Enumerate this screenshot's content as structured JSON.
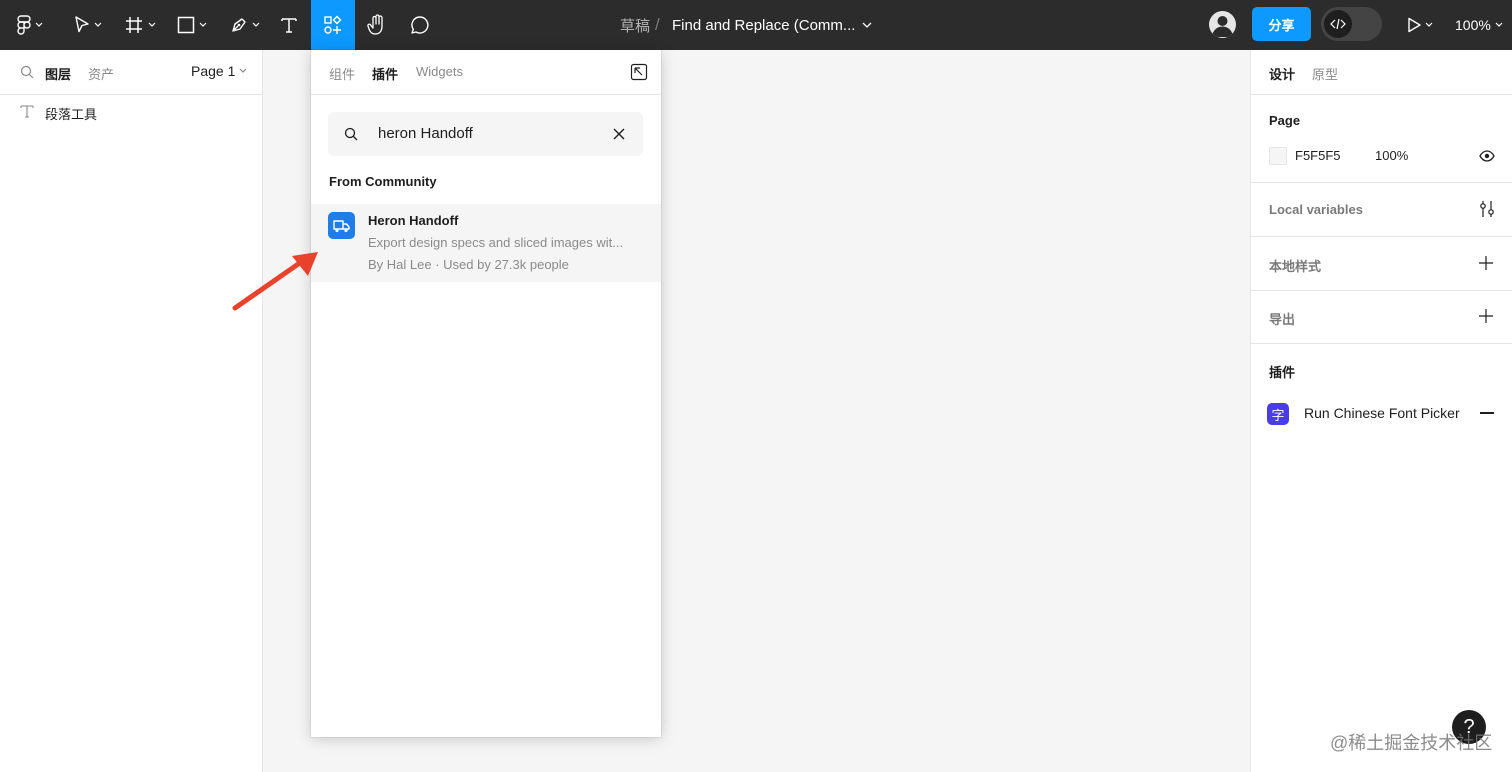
{
  "toolbar": {
    "breadcrumb_draft": "草稿",
    "breadcrumb_sep": "/",
    "file_name": "Find and Replace (Comm...",
    "share_label": "分享",
    "zoom": "100%"
  },
  "left_panel": {
    "tab_layers": "图层",
    "tab_assets": "资产",
    "page_selector": "Page 1",
    "layers": [
      {
        "name": "段落工具",
        "icon": "text-icon"
      }
    ]
  },
  "plugin_popover": {
    "tabs": [
      "组件",
      "插件",
      "Widgets"
    ],
    "active_tab": "插件",
    "search_value": "heron Handoff",
    "section_label": "From Community",
    "results": [
      {
        "title": "Heron Handoff",
        "description": "Export design specs and sliced images wit...",
        "meta": "By Hal Lee · Used by 27.3k people",
        "icon": "truck-icon"
      }
    ]
  },
  "right_panel": {
    "tab_design": "设计",
    "tab_prototype": "原型",
    "page_section": {
      "title": "Page",
      "color_hex": "F5F5F5",
      "opacity": "100%"
    },
    "local_variables": "Local variables",
    "local_styles": "本地样式",
    "export": "导出",
    "plugins_title": "插件",
    "plugin_item": {
      "icon_char": "字",
      "label": "Run Chinese Font Picker"
    }
  },
  "help_label": "?",
  "watermark": "@稀土掘金技术社区",
  "colors": {
    "toolbar_bg": "#2c2c2c",
    "accent": "#0d99ff",
    "canvas": "#f5f5f5",
    "annotation_arrow": "#e8412c"
  }
}
